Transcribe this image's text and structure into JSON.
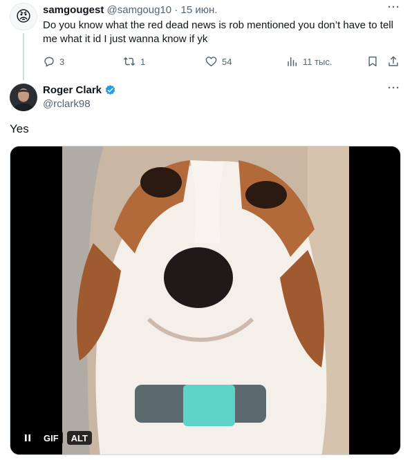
{
  "reply_tweet": {
    "avatar_emoji": "😡",
    "name": "samgougest",
    "handle": "@samgoug10",
    "separator": "·",
    "date": "15 июн.",
    "text": "Do you know what the red dead news is rob mentioned you don’t have to tell me what it id I just wanna know if yk",
    "actions": {
      "replies": "3",
      "retweets": "1",
      "likes": "54",
      "views": "11 тыс."
    }
  },
  "main_tweet": {
    "name": "Roger Clark",
    "handle": "@rclark98",
    "text": "Yes",
    "media": {
      "badge_gif": "GIF",
      "badge_alt": "ALT"
    }
  },
  "colors": {
    "text_primary": "#0f1419",
    "text_secondary": "#536471",
    "verified_blue": "#1d9bf0",
    "thread_line": "#cfd9de"
  },
  "icons": [
    "more-icon",
    "reply-icon",
    "retweet-icon",
    "like-icon",
    "views-icon",
    "bookmark-icon",
    "share-icon",
    "verified-badge-icon",
    "pause-icon"
  ]
}
